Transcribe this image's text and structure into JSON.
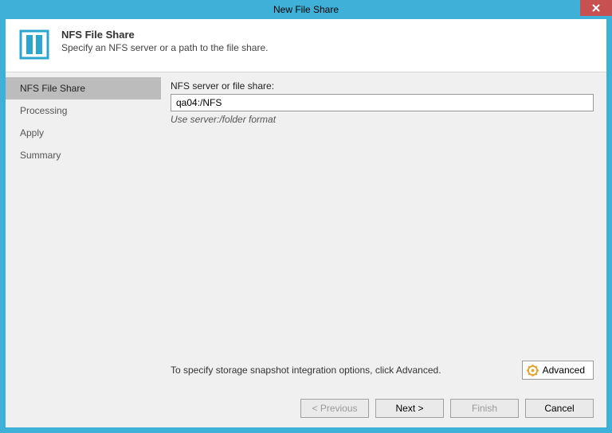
{
  "window": {
    "title": "New File Share"
  },
  "header": {
    "title": "NFS File Share",
    "subtitle": "Specify an NFS server or a path to the file share."
  },
  "sidebar": {
    "items": [
      {
        "label": "NFS File Share",
        "active": true
      },
      {
        "label": "Processing",
        "active": false
      },
      {
        "label": "Apply",
        "active": false
      },
      {
        "label": "Summary",
        "active": false
      }
    ]
  },
  "form": {
    "server_label": "NFS server or file share:",
    "server_value": "qa04:/NFS",
    "server_hint": "Use server:/folder format",
    "snapshot_text": "To specify storage snapshot integration options, click Advanced.",
    "advanced_label": "Advanced"
  },
  "footer": {
    "previous": "< Previous",
    "next": "Next >",
    "finish": "Finish",
    "cancel": "Cancel"
  }
}
